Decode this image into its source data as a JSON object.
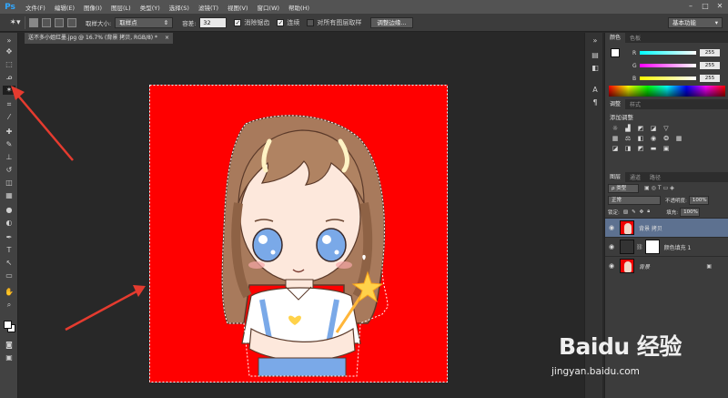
{
  "app": {
    "logo": "Ps"
  },
  "menu": [
    "文件(F)",
    "编辑(E)",
    "图像(I)",
    "图层(L)",
    "类型(Y)",
    "选择(S)",
    "滤镜(T)",
    "视图(V)",
    "窗口(W)",
    "帮助(H)"
  ],
  "window_controls": {
    "minimize": "–",
    "maximize": "□",
    "close": "✕"
  },
  "options_bar": {
    "sample_size_label": "取样大小:",
    "sample_size_value": "取样点",
    "tolerance_label": "容差:",
    "tolerance_value": "32",
    "antialias_label": "消除锯齿",
    "antialias_checked": true,
    "contiguous_label": "连续",
    "contiguous_checked": true,
    "all_layers_label": "对所有图层取样",
    "all_layers_checked": false,
    "refine_edge_label": "调整边缘...",
    "workspace": "基本功能"
  },
  "document_tab": {
    "title": "送不多小姐红墨.jpg @ 16.7% (背景 拷贝, RGB/8) *",
    "close": "×"
  },
  "tools": [
    {
      "name": "move-tool",
      "glyph": "✥"
    },
    {
      "name": "marquee-tool",
      "glyph": "⬚"
    },
    {
      "name": "lasso-tool",
      "glyph": "ᓄ"
    },
    {
      "name": "magic-wand-tool",
      "glyph": "✶"
    },
    {
      "name": "crop-tool",
      "glyph": "⌗"
    },
    {
      "name": "eyedropper-tool",
      "glyph": "⁄"
    },
    {
      "name": "healing-tool",
      "glyph": "✚"
    },
    {
      "name": "brush-tool",
      "glyph": "✎"
    },
    {
      "name": "stamp-tool",
      "glyph": "⊥"
    },
    {
      "name": "history-brush-tool",
      "glyph": "↺"
    },
    {
      "name": "eraser-tool",
      "glyph": "◫"
    },
    {
      "name": "gradient-tool",
      "glyph": "▦"
    },
    {
      "name": "blur-tool",
      "glyph": "●"
    },
    {
      "name": "dodge-tool",
      "glyph": "◐"
    },
    {
      "name": "pen-tool",
      "glyph": "✒"
    },
    {
      "name": "type-tool",
      "glyph": "T"
    },
    {
      "name": "path-select-tool",
      "glyph": "↖"
    },
    {
      "name": "shape-tool",
      "glyph": "▭"
    },
    {
      "name": "hand-tool",
      "glyph": "✋"
    },
    {
      "name": "zoom-tool",
      "glyph": "⌕"
    }
  ],
  "color_panel": {
    "tabs": [
      "颜色",
      "色板"
    ],
    "r_label": "R",
    "g_label": "G",
    "b_label": "B",
    "r_value": "255",
    "g_value": "255",
    "b_value": "255"
  },
  "adjustments_panel": {
    "tabs": [
      "调整",
      "样式"
    ],
    "title": "添加调整"
  },
  "layers_panel": {
    "tabs": [
      "图层",
      "通道",
      "路径"
    ],
    "filter": "ρ 类型",
    "blend_mode": "正常",
    "opacity_label": "不透明度:",
    "opacity_value": "100%",
    "lock_label": "锁定:",
    "fill_label": "填充:",
    "fill_value": "100%",
    "layers": [
      {
        "name": "背景 拷贝",
        "selected": true
      },
      {
        "name": "颜色填充 1",
        "selected": false
      },
      {
        "name": "背景",
        "selected": false
      }
    ]
  },
  "colors": {
    "canvas_bg": "#ff0000",
    "selected_layer": "#5d7190",
    "annotation": "#e53b2f"
  },
  "watermark": {
    "brand": "Baidu 经验",
    "url": "jingyan.baidu.com"
  }
}
